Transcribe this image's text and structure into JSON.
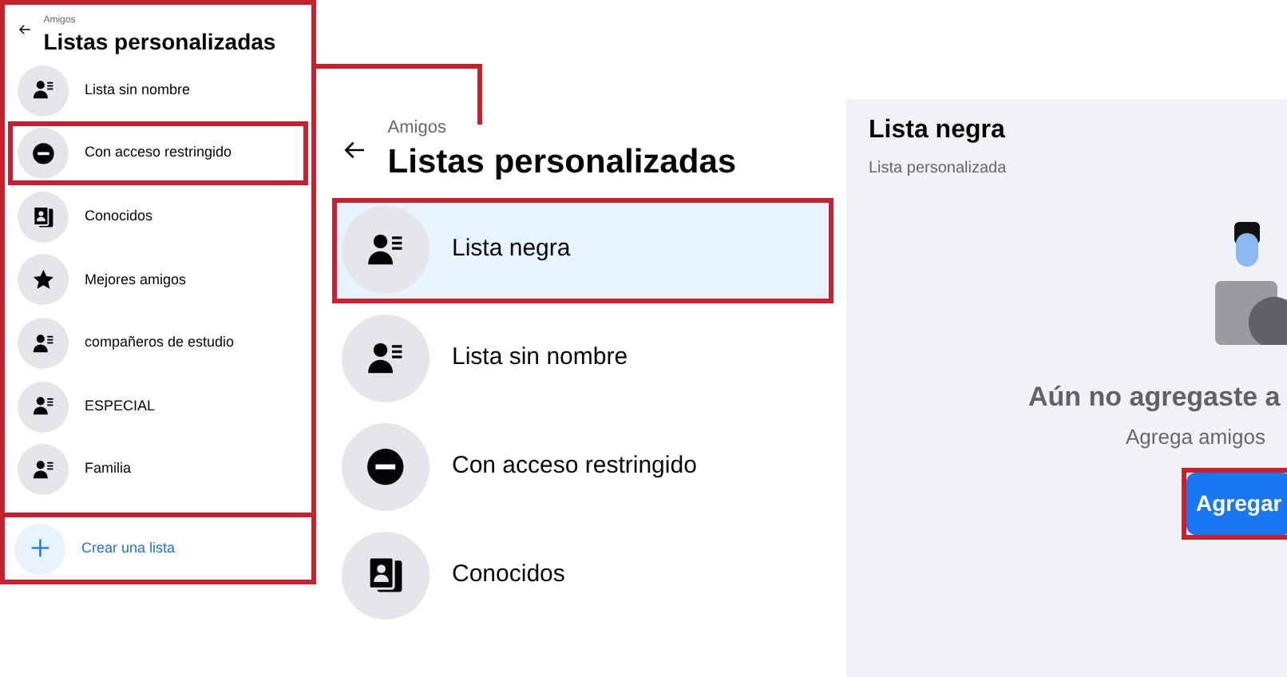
{
  "left_panel": {
    "breadcrumb": "Amigos",
    "title": "Listas personalizadas",
    "highlighted": true,
    "items": [
      {
        "label": "Lista sin nombre",
        "kind": "person-list",
        "highlighted": false
      },
      {
        "label": "Con acceso restringido",
        "kind": "restricted",
        "highlighted": true
      },
      {
        "label": "Conocidos",
        "kind": "contacts",
        "highlighted": false
      },
      {
        "label": "Mejores amigos",
        "kind": "star",
        "highlighted": false
      },
      {
        "label": "compañeros de estudio",
        "kind": "person-list",
        "highlighted": false
      },
      {
        "label": "ESPECIAL",
        "kind": "person-list",
        "highlighted": false
      },
      {
        "label": "Familia",
        "kind": "person-list",
        "highlighted": false
      }
    ],
    "create": {
      "label": "Crear una lista",
      "highlighted": true
    }
  },
  "main_panel": {
    "breadcrumb": "Amigos",
    "title": "Listas personalizadas",
    "items": [
      {
        "label": "Lista negra",
        "kind": "person-list",
        "selected": true,
        "highlighted": true
      },
      {
        "label": "Lista sin nombre",
        "kind": "person-list",
        "selected": false,
        "highlighted": false
      },
      {
        "label": "Con acceso restringido",
        "kind": "restricted",
        "selected": false,
        "highlighted": false
      },
      {
        "label": "Conocidos",
        "kind": "contacts",
        "selected": false,
        "highlighted": false
      }
    ]
  },
  "detail": {
    "title": "Lista negra",
    "subtitle": "Lista personalizada",
    "empty_title": "Aún no agregaste a",
    "empty_text": "Agrega amigos",
    "button": {
      "label": "Agregar",
      "highlighted": true
    }
  }
}
